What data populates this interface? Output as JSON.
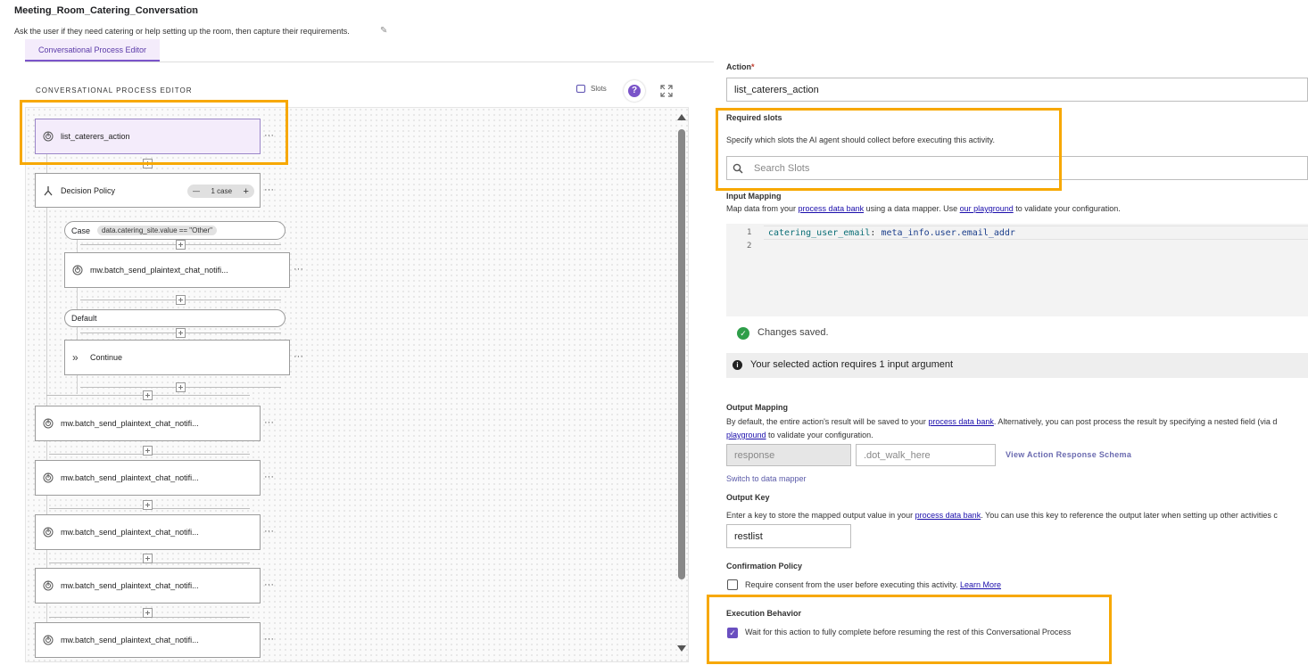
{
  "header": {
    "title": "Meeting_Room_Catering_Conversation",
    "description": "Ask the user if they need catering or help setting up the room, then capture their requirements.",
    "edit_icon": "pencil-icon"
  },
  "tabs": [
    {
      "label": "Conversational Process Editor",
      "active": true
    }
  ],
  "editor": {
    "title": "CONVERSATIONAL PROCESS EDITOR",
    "slots_label": "Slots",
    "help_glyph": "?",
    "nodes": {
      "first_action": "list_caterers_action",
      "decision_policy": "Decision Policy",
      "case_counter": "1 case",
      "case_label": "Case",
      "case_condition": "data.catering_site.value == \"Other\"",
      "case_action": "mw.batch_send_plaintext_chat_notifi...",
      "default_label": "Default",
      "continue_label": "Continue",
      "action_2": "mw.batch_send_plaintext_chat_notifi...",
      "action_3": "mw.batch_send_plaintext_chat_notifi...",
      "action_4": "mw.batch_send_plaintext_chat_notifi...",
      "action_5": "mw.batch_send_plaintext_chat_notifi...",
      "action_6": "mw.batch_send_plaintext_chat_notifi..."
    },
    "more_glyph": "···"
  },
  "panel": {
    "action_label": "Action",
    "action_required_mark": "*",
    "action_value": "list_caterers_action",
    "required_slots": {
      "label": "Required slots",
      "help": "Specify which slots the AI agent should collect before executing this activity.",
      "search_placeholder": "Search Slots"
    },
    "input_mapping": {
      "label": "Input Mapping",
      "help_prefix": "Map data from your ",
      "help_link1": "process data bank",
      "help_mid": " using a data mapper. Use ",
      "help_link2": "our playground",
      "help_suffix": " to validate your configuration.",
      "line1": "1",
      "line2": "2",
      "code_key": "catering_user_email",
      "code_sep": ": ",
      "code_value": "meta_info.user.email_addr"
    },
    "saved_status": "Changes saved.",
    "info_message": "Your selected action requires 1 input argument",
    "output_mapping": {
      "label": "Output Mapping",
      "help_prefix": "By default, the entire action's result will be saved to your ",
      "help_link1": "process data bank",
      "help_suffix": ". Alternatively, you can post process the result by specifying a nested field (via d",
      "help_link2": "playground",
      "help_suffix2": " to validate your configuration.",
      "response_value": "response",
      "dot_walk_placeholder": ".dot_walk_here",
      "view_schema": "View Action Response Schema",
      "switch_mapper": "Switch to data mapper"
    },
    "output_key": {
      "label": "Output Key",
      "help_prefix": "Enter a key to store the mapped output value in your ",
      "help_link": "process data bank",
      "help_suffix": ". You can use this key to reference the output later when setting up other activities c",
      "value": "restlist"
    },
    "confirmation": {
      "label": "Confirmation Policy",
      "checkbox_text": "Require consent from the user before executing this activity.",
      "learn_more": "Learn More",
      "checked": false
    },
    "execution": {
      "label": "Execution Behavior",
      "checkbox_text": "Wait for this action to fully complete before resuming the rest of this Conversational Process",
      "checked": true
    }
  },
  "colors": {
    "accent": "#7a54c9",
    "highlight": "#f7a800",
    "success": "#2e9e49",
    "link": "#1a0dab"
  }
}
